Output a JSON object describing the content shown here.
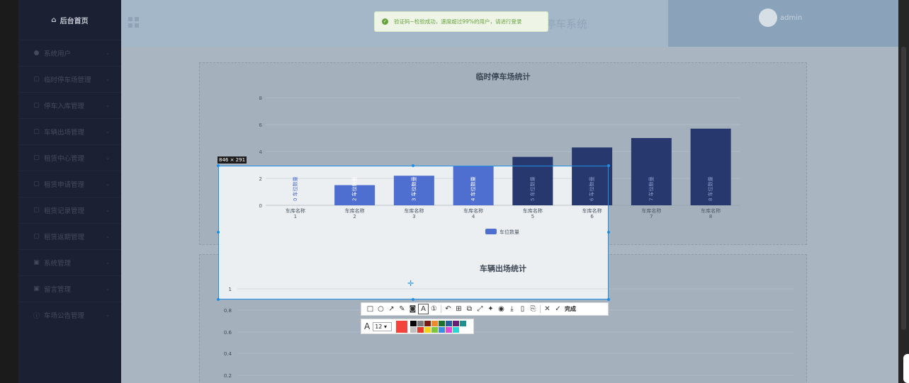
{
  "sidebar": {
    "home": {
      "icon": "home-icon",
      "label": "后台首页"
    },
    "items": [
      {
        "icon": "user-icon",
        "label": "系统用户"
      },
      {
        "icon": "square-icon",
        "label": "临时停车场管理"
      },
      {
        "icon": "square-icon",
        "label": "停车入库管理"
      },
      {
        "icon": "square-icon",
        "label": "车辆出场管理"
      },
      {
        "icon": "square-icon",
        "label": "租赁中心管理"
      },
      {
        "icon": "square-icon",
        "label": "租赁申请管理"
      },
      {
        "icon": "square-icon",
        "label": "租赁记录管理"
      },
      {
        "icon": "square-icon",
        "label": "租赁返期管理"
      },
      {
        "icon": "image-icon",
        "label": "系统管理"
      },
      {
        "icon": "image-icon",
        "label": "留言管理"
      },
      {
        "icon": "info-icon",
        "label": "车场公告管理"
      }
    ]
  },
  "header": {
    "title": "停车系统",
    "username": "admin",
    "toast": "验证码~检验成功，速度超过99%的用户，请进行登录"
  },
  "screenshot_tool": {
    "dimension_label": "846 × 291",
    "done_label": "完成",
    "font_size": "12",
    "current_color": "#f4433d",
    "swatches": [
      "#000000",
      "#7a7a7a",
      "#7a1c13",
      "#ec8a30",
      "#1f6f31",
      "#285d9e",
      "#6a1f75",
      "#1f8f8f",
      "#ffffff",
      "#c0c0c0",
      "#e8392f",
      "#f6d31d",
      "#7fc638",
      "#3f8fe0",
      "#e549d6",
      "#2dd4d4"
    ]
  },
  "chart_data": [
    {
      "type": "bar",
      "title": "临时停车场统计",
      "categories": [
        "车库名称\n1",
        "车库名称\n2",
        "车库名称\n3",
        "车库名称\n4",
        "车库名称\n5",
        "车库名称\n6",
        "车库名称\n7",
        "车库名称\n8"
      ],
      "bar_labels": [
        "0 车位数量",
        "2 车位数量",
        "3 车位数量",
        "4 车位数量",
        "5 车位数量",
        "6 车位数量",
        "7 车位数量",
        "8 车位数量"
      ],
      "series": [
        {
          "name": "车位数量",
          "values": [
            0,
            1.5,
            2.2,
            2.9,
            3.6,
            4.3,
            5.0,
            5.7
          ]
        }
      ],
      "ylim": [
        0,
        8
      ],
      "yticks": [
        0,
        2,
        4,
        6,
        8
      ],
      "grid": true,
      "legend": "bottom-center",
      "color": "#4f6fd0"
    },
    {
      "type": "bar",
      "title": "车辆出场统计",
      "ylim": [
        0,
        1
      ],
      "yticks": [
        0.2,
        0.4,
        0.6,
        0.8,
        1
      ],
      "grid": true
    }
  ]
}
